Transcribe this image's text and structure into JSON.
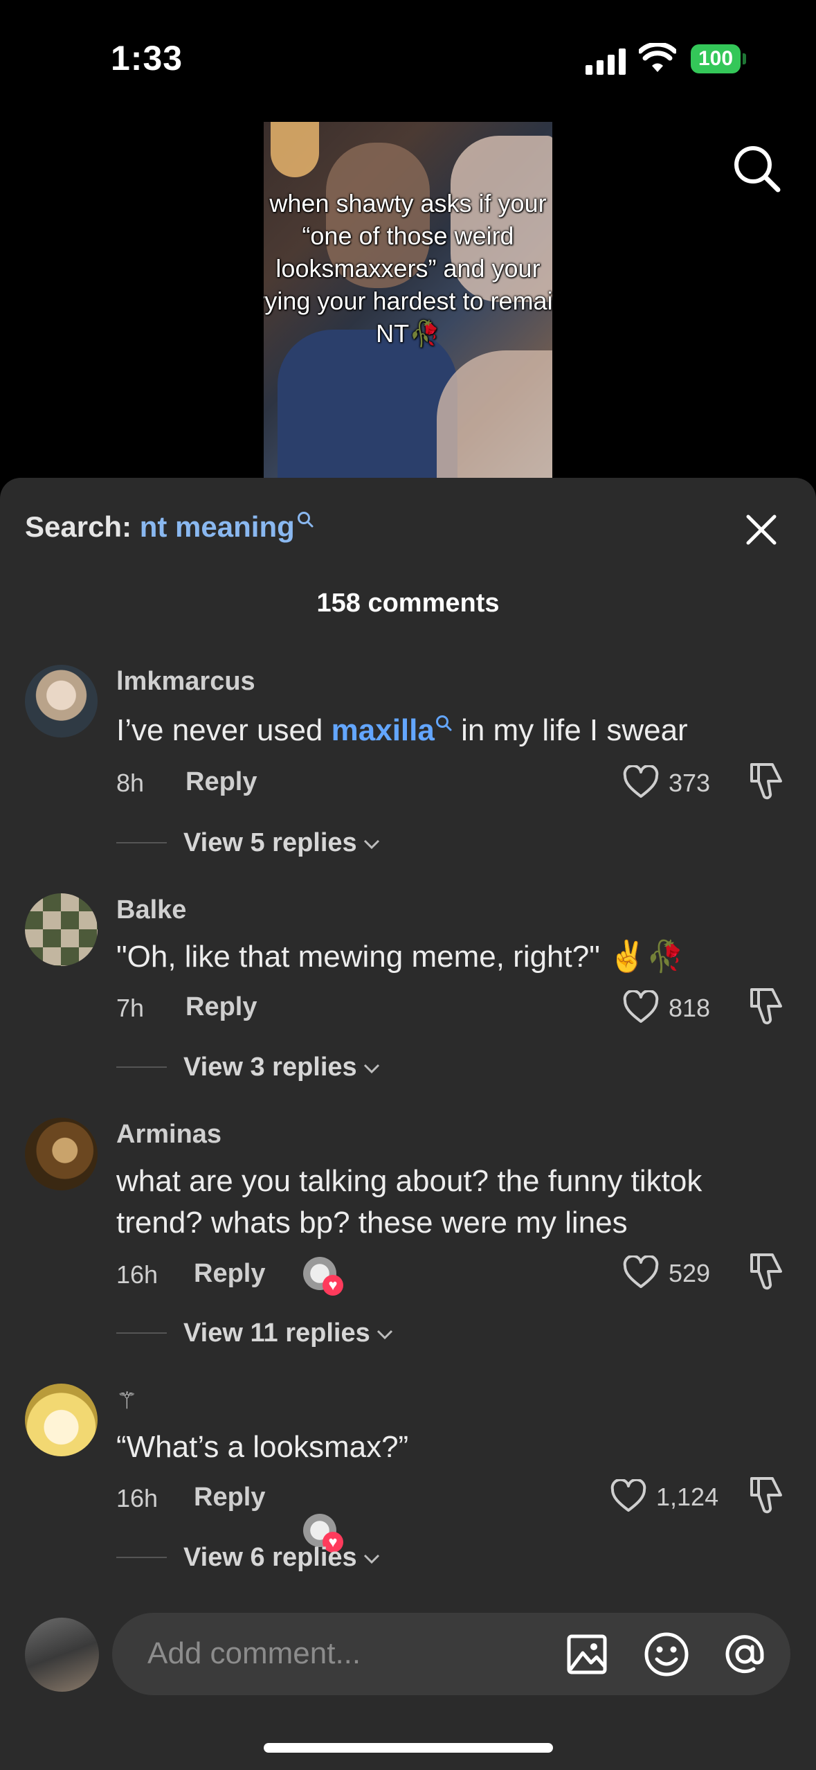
{
  "status": {
    "time": "1:33",
    "battery": "100"
  },
  "video": {
    "caption": "when shawty asks if your “one of those weird looksmaxxers” and your trying your hardest to remain NT🥀"
  },
  "search": {
    "prefix": "Search:",
    "query": "nt meaning"
  },
  "comments_count": "158 comments",
  "comments": [
    {
      "username": "lmkmarcus",
      "text_before": "I’ve never used ",
      "link": "maxilla",
      "text_after": " in my life I swear",
      "time": "8h",
      "reply": "Reply",
      "likes": "373",
      "view_replies": "View 5 replies",
      "avatar_color": "#c9b8a8"
    },
    {
      "username": "Balke",
      "text": "\"Oh, like that mewing meme, right?\" ✌️🥀",
      "time": "7h",
      "reply": "Reply",
      "likes": "818",
      "view_replies": "View 3 replies",
      "avatar_color": "#5b6b4a"
    },
    {
      "username": "Arminas",
      "text": "what are you talking about? the funny tiktok trend? whats bp? these were my lines",
      "time": "16h",
      "reply": "Reply",
      "likes": "529",
      "view_replies": "View 11 replies",
      "avatar_color": "#7a5528"
    },
    {
      "username": "⚚",
      "text": "“What’s a looksmax?”",
      "time": "16h",
      "reply": "Reply",
      "likes": "1,124",
      "view_replies": "View 6 replies",
      "avatar_color": "#f4e7a8"
    }
  ],
  "composer": {
    "placeholder": "Add comment..."
  },
  "colors": {
    "sheet": "#2b2b2b",
    "link": "#63a6ff",
    "search_query": "#8ab8f0",
    "battery": "#34c759",
    "heart_badge": "#ff3b5c"
  }
}
